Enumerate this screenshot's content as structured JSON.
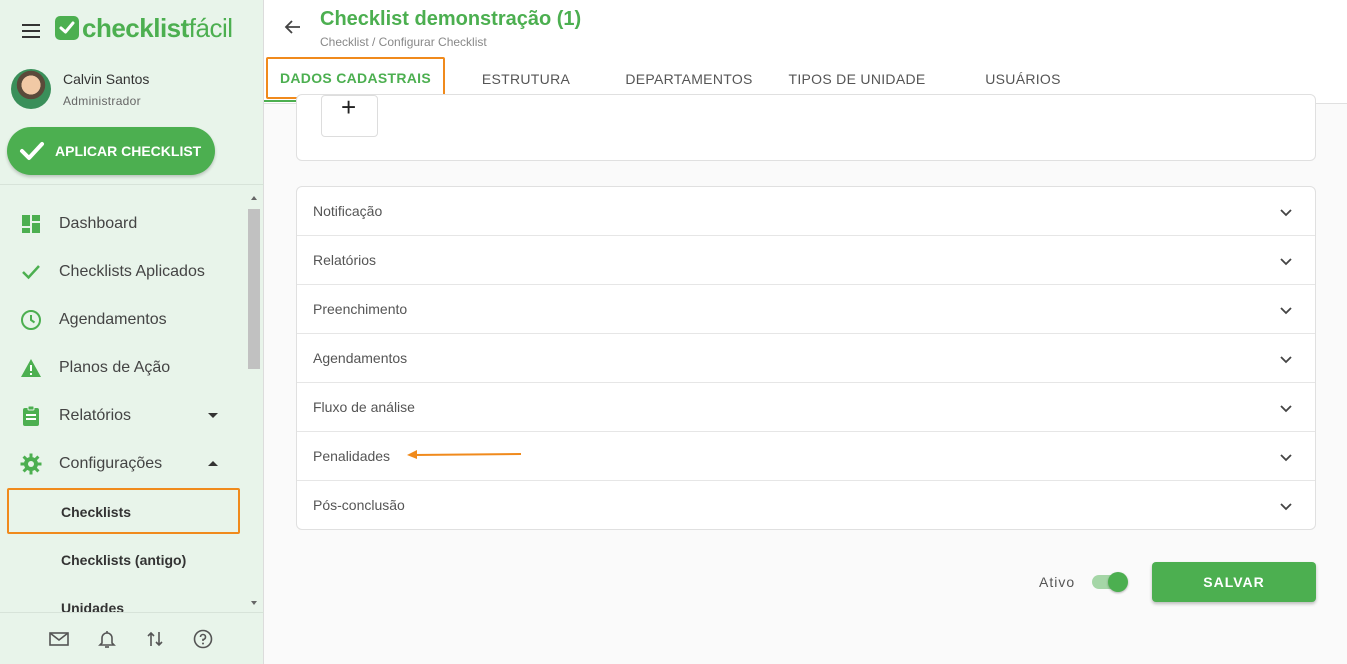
{
  "app": {
    "logo_part1": "checklist",
    "logo_part2": "fácil",
    "brand_color": "#4caf50",
    "highlight_color": "#f08a1c"
  },
  "user": {
    "name": "Calvin Santos",
    "role": "Administrador"
  },
  "sidebar": {
    "apply_button": "APLICAR CHECKLIST",
    "items": [
      {
        "label": "Dashboard",
        "icon": "dashboard-icon"
      },
      {
        "label": "Checklists Aplicados",
        "icon": "check-icon"
      },
      {
        "label": "Agendamentos",
        "icon": "clock-icon"
      },
      {
        "label": "Planos de Ação",
        "icon": "warning-icon"
      },
      {
        "label": "Relatórios",
        "icon": "clipboard-icon",
        "expandable": true,
        "expanded": false
      },
      {
        "label": "Configurações",
        "icon": "gear-icon",
        "expandable": true,
        "expanded": true
      }
    ],
    "sub_items": [
      {
        "label": "Checklists",
        "selected": true
      },
      {
        "label": "Checklists (antigo)"
      },
      {
        "label": "Unidades"
      }
    ],
    "footer_icons": [
      "mail-icon",
      "bell-icon",
      "sync-arrows-icon",
      "help-icon"
    ]
  },
  "header": {
    "title": "Checklist demonstração (1)",
    "breadcrumb": "Checklist / Configurar Checklist",
    "tabs": [
      {
        "label": "DADOS CADASTRAIS",
        "active": true
      },
      {
        "label": "ESTRUTURA"
      },
      {
        "label": "DEPARTAMENTOS"
      },
      {
        "label": "TIPOS DE UNIDADE"
      },
      {
        "label": "USUÁRIOS"
      }
    ]
  },
  "main": {
    "add_button": "+",
    "sections": [
      {
        "label": "Notificação"
      },
      {
        "label": "Relatórios"
      },
      {
        "label": "Preenchimento"
      },
      {
        "label": "Agendamentos"
      },
      {
        "label": "Fluxo de análise"
      },
      {
        "label": "Penalidades",
        "annotated": true
      },
      {
        "label": "Pós-conclusão"
      }
    ],
    "active_label": "Ativo",
    "active_value": true,
    "save_label": "SALVAR"
  }
}
